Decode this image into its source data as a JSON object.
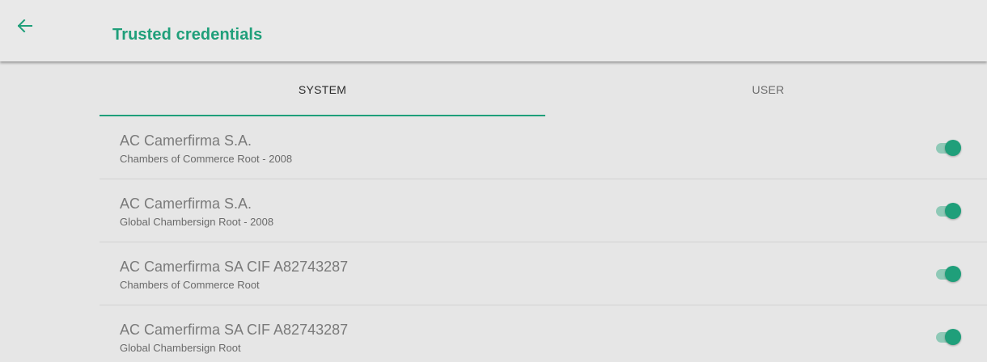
{
  "header": {
    "title": "Trusted credentials",
    "back_icon": "arrow-back-icon"
  },
  "tabs": [
    {
      "label": "SYSTEM",
      "selected": true
    },
    {
      "label": "USER",
      "selected": false
    }
  ],
  "credentials": [
    {
      "title": "AC Camerfirma S.A.",
      "subtitle": "Chambers of Commerce Root - 2008",
      "enabled": true
    },
    {
      "title": "AC Camerfirma S.A.",
      "subtitle": "Global Chambersign Root - 2008",
      "enabled": true
    },
    {
      "title": "AC Camerfirma SA CIF A82743287",
      "subtitle": "Chambers of Commerce Root",
      "enabled": true
    },
    {
      "title": "AC Camerfirma SA CIF A82743287",
      "subtitle": "Global Chambersign Root",
      "enabled": true
    }
  ],
  "colors": {
    "accent": "#1f9f7a",
    "background": "#e6e6e6",
    "toolbar": "#e9e9e9"
  }
}
